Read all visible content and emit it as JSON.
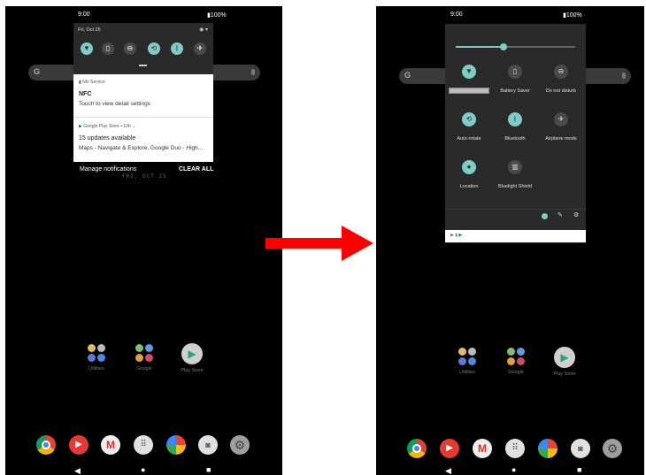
{
  "left": {
    "status": {
      "time": "9:00",
      "battery": "100%"
    },
    "shade_date": "Fri, Oct 25",
    "notifications": [
      {
        "app": "Nfc Service",
        "title": "NFC",
        "body": "Touch to view detail settings"
      },
      {
        "app": "Google Play Store • 10h ⌄",
        "title": "15 updates available",
        "body": "Maps - Navigate & Explore, Google Duo - High..."
      }
    ],
    "manage_label": "Manage notifications",
    "clear_label": "CLEAR ALL",
    "faint_date": "FRI, OCT 25",
    "apps": {
      "utilities": "Utilities",
      "google": "Google",
      "play_store": "Play Store"
    }
  },
  "right": {
    "status": {
      "time": "9:00",
      "battery": "100%"
    },
    "brightness_level": 0.4,
    "tiles": [
      {
        "icon": "wifi-icon",
        "label": "",
        "on": true
      },
      {
        "icon": "battery-saver-icon",
        "label": "Battery Saver",
        "on": false
      },
      {
        "icon": "do-not-disturb-icon",
        "label": "Do not disturb",
        "on": false
      },
      {
        "icon": "auto-rotate-icon",
        "label": "Auto-rotate",
        "on": true
      },
      {
        "icon": "bluetooth-icon",
        "label": "Bluetooth",
        "on": true
      },
      {
        "icon": "airplane-icon",
        "label": "Airplane mode",
        "on": false
      },
      {
        "icon": "location-icon",
        "label": "Location",
        "on": true
      },
      {
        "icon": "bluelight-shield-icon",
        "label": "Bluelight Shield",
        "on": false
      }
    ],
    "apps": {
      "utilities": "Utilities",
      "google": "Google",
      "play_store": "Play Store"
    }
  },
  "colors": {
    "accent": "#80cbc4",
    "arrow": "#ff0000"
  }
}
